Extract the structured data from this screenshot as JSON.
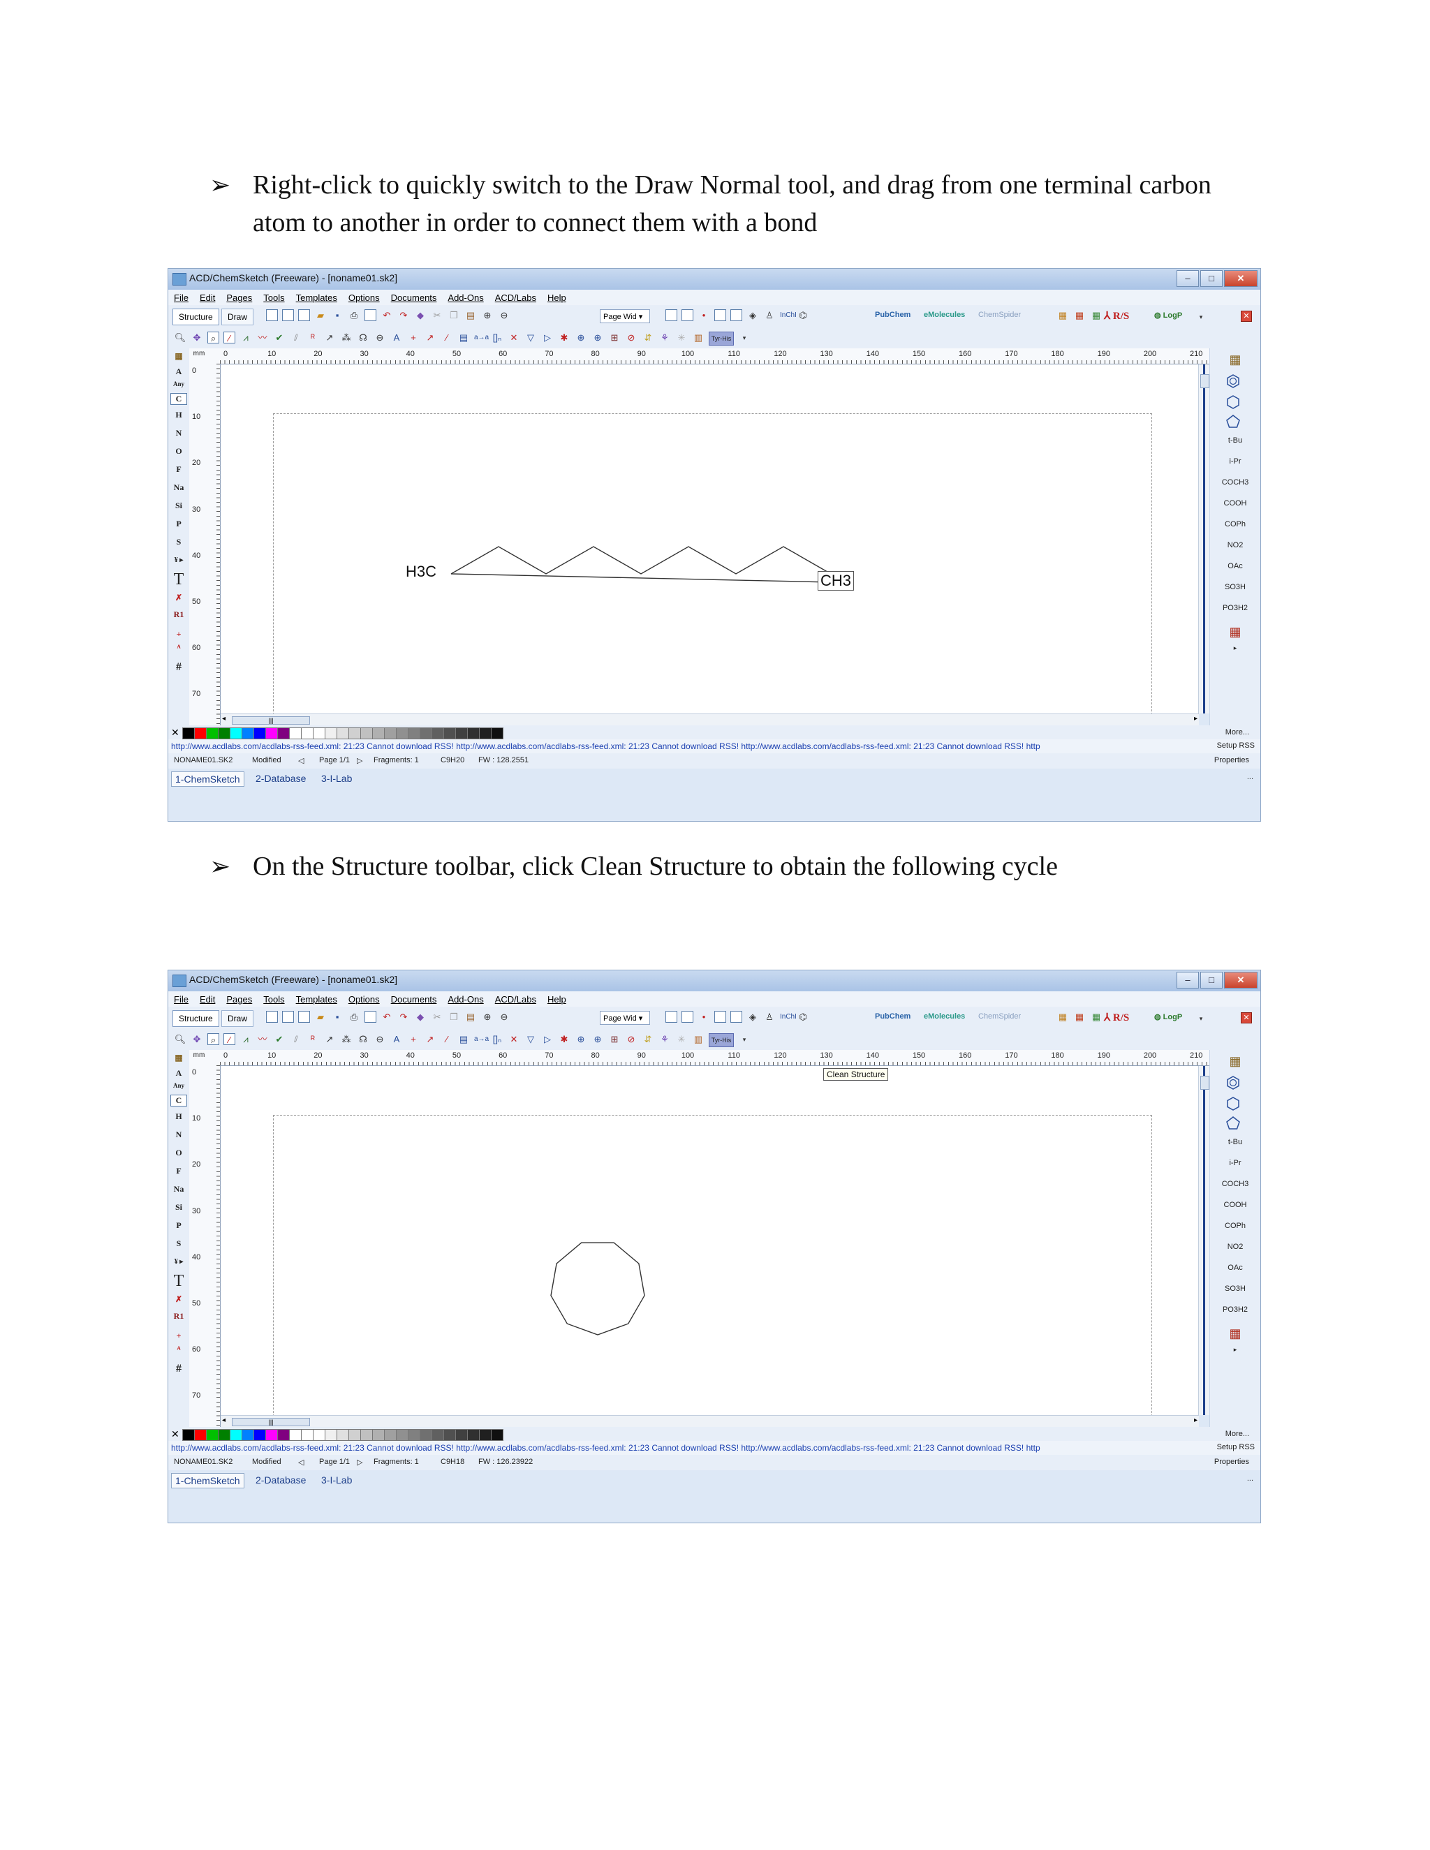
{
  "instructions": [
    {
      "bullet": "➢",
      "text": "Right-click to quickly switch to the Draw Normal tool, and drag from one terminal carbon atom to another in order to connect them with a bond"
    },
    {
      "bullet": "➢",
      "text": "On the Structure toolbar, click Clean Structure to obtain the following cycle"
    }
  ],
  "window": {
    "title": "ACD/ChemSketch (Freeware) - [noname01.sk2]",
    "menu": [
      "File",
      "Edit",
      "Pages",
      "Tools",
      "Templates",
      "Options",
      "Documents",
      "Add-Ons",
      "ACD/Labs",
      "Help"
    ],
    "mode_tabs": [
      "Structure",
      "Draw"
    ],
    "zoom_select": "Page Wid",
    "pubchem": "PubChem",
    "emolecules": "eMolecules",
    "chemspider": "ChemSpider",
    "rs_label": "R/S",
    "logp_label": "LogP",
    "ruler_unit": "mm",
    "ruler_top_ticks": [
      "0",
      "10",
      "20",
      "30",
      "40",
      "50",
      "60",
      "70",
      "80",
      "90",
      "100",
      "110",
      "120",
      "130",
      "140",
      "150",
      "160",
      "170",
      "180",
      "190",
      "200",
      "210",
      "2"
    ],
    "ruler_left_ticks": [
      "0",
      "10",
      "20",
      "30",
      "40",
      "50",
      "60",
      "70"
    ],
    "left_elements": [
      "A",
      "Any",
      "C",
      "H",
      "N",
      "O",
      "F",
      "Na",
      "Si",
      "P",
      "S"
    ],
    "left_tools": [
      "T",
      "R1",
      "#"
    ],
    "right_labels": [
      "t-Bu",
      "i-Pr",
      "COCH3",
      "COOH",
      "COPh",
      "NO2",
      "OAc",
      "SO3H",
      "PO3H2"
    ],
    "more_label": "More...",
    "rss_text": "http://www.acdlabs.com/acdlabs-rss-feed.xml: 21:23 Cannot download RSS!  http://www.acdlabs.com/acdlabs-rss-feed.xml: 21:23 Cannot download RSS!  http://www.acdlabs.com/acdlabs-rss-feed.xml: 21:23 Cannot download RSS!  http",
    "setup_rss": "Setup RSS",
    "properties": "Properties",
    "bottom_tabs": [
      "1-ChemSketch",
      "2-Database",
      "3-I-Lab"
    ],
    "bottom_dots": "..."
  },
  "screens": [
    {
      "status": {
        "file": "NONAME01.SK2",
        "modified": "Modified",
        "page": "Page 1/1",
        "fragments": "Fragments: 1",
        "formula": "C9H20",
        "fw": "FW : 128.2551"
      },
      "labels": {
        "left": "H3C",
        "right": "CH3"
      }
    },
    {
      "status": {
        "file": "NONAME01.SK2",
        "modified": "Modified",
        "page": "Page 1/1",
        "fragments": "Fragments: 1",
        "formula": "C9H18",
        "fw": "FW : 126.23922"
      },
      "tooltip": "Clean Structure"
    }
  ],
  "colors": {
    "palette": [
      "#000000",
      "#ff0000",
      "#00c000",
      "#008000",
      "#00ffff",
      "#0080ff",
      "#0000ff",
      "#ff00ff",
      "#800080",
      "#ffffff",
      "#ffffff",
      "#ffffff",
      "#f0f0f0",
      "#e0e0e0",
      "#d0d0d0",
      "#c0c0c0",
      "#b0b0b0",
      "#a0a0a0",
      "#909090",
      "#808080",
      "#707070",
      "#606060",
      "#505050",
      "#404040",
      "#303030",
      "#202020",
      "#101010"
    ]
  }
}
